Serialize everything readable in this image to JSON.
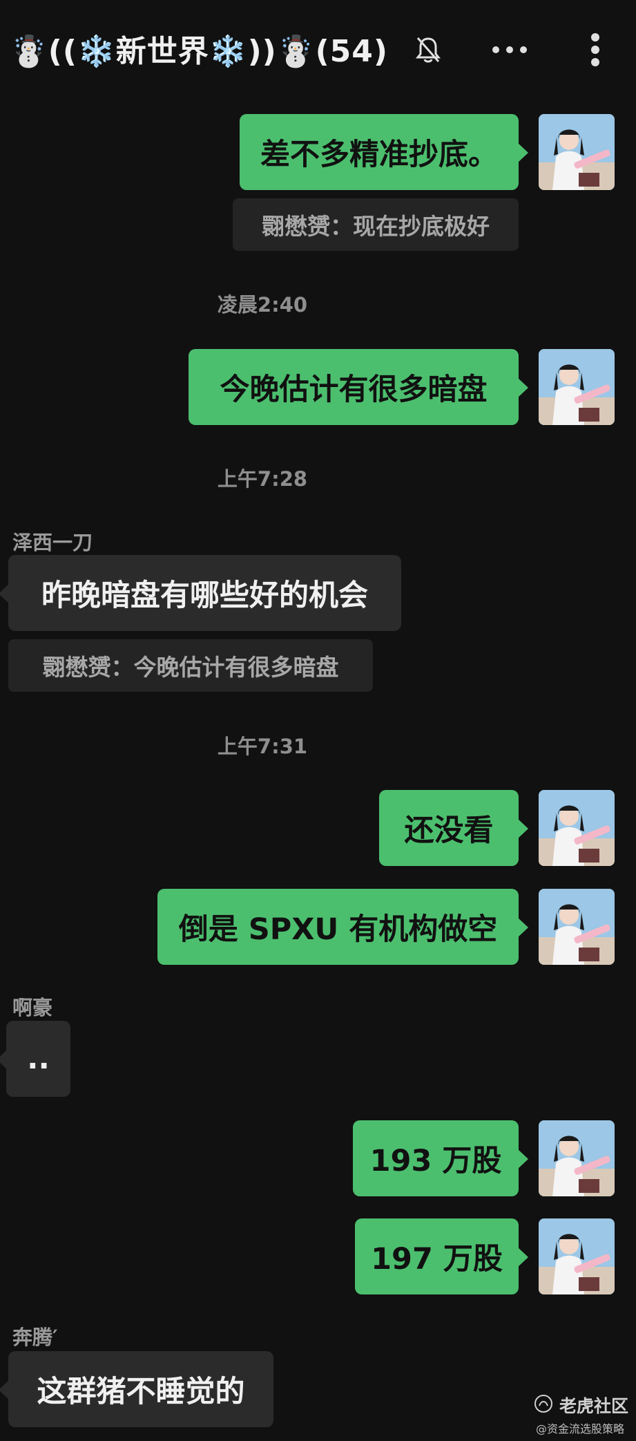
{
  "header": {
    "title": "☃️((❄️新世界❄️))☃️(54)",
    "mute_icon": "bell-off-icon",
    "more_icon": "ellipsis-horizontal-icon",
    "menu_icon": "kebab-vertical-icon"
  },
  "messages": {
    "m1": "差不多精准抄底。",
    "q1": "翾懋赟：现在抄底极好",
    "t1": "凌晨2:40",
    "m2": "今晚估计有很多暗盘",
    "t2": "上午7:28",
    "s1": "泽西一刀",
    "m3": "昨晚暗盘有哪些好的机会",
    "q2": "翾懋赟：今晚估计有很多暗盘",
    "t3": "上午7:31",
    "m4": "还没看",
    "m5": "倒是 SPXU 有机构做空",
    "s2": "啊豪",
    "m6": "..",
    "m7": "193 万股",
    "m8": "197 万股",
    "s3": "奔腾′",
    "m9": "这群猪不睡觉的"
  },
  "watermark": {
    "brand": "老虎社区",
    "handle": "@资金流选股策略"
  },
  "colors": {
    "background": "#111111",
    "outgoing_bubble": "#4cbf6e",
    "incoming_bubble": "#2b2b2b",
    "quote_bubble": "#242424"
  }
}
